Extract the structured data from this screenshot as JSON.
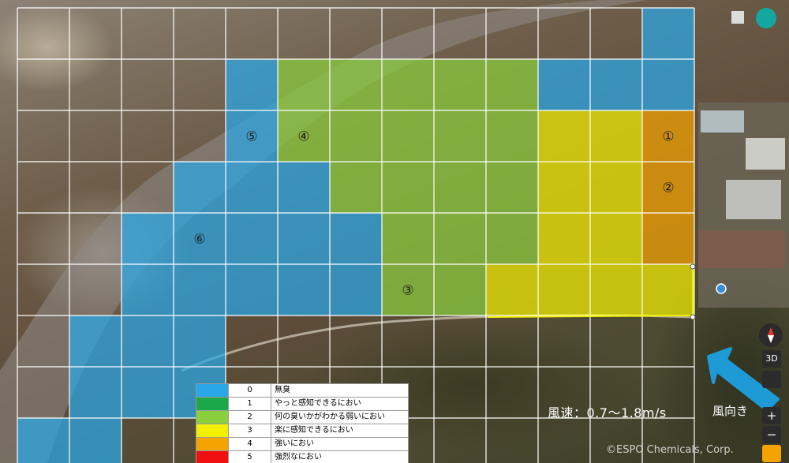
{
  "map": {
    "grid": {
      "columns": 13,
      "rows": 9
    },
    "odor_colors": {
      "0": "#2aa7e8",
      "1": "#1aa84a",
      "2": "#8ccf3e",
      "3": "#f2ef00",
      "4": "#f5a300",
      "5": "#f01010"
    },
    "levels": [
      [
        null,
        null,
        null,
        null,
        null,
        null,
        null,
        null,
        null,
        null,
        null,
        null,
        0
      ],
      [
        null,
        null,
        null,
        null,
        0,
        2,
        2,
        2,
        2,
        2,
        0,
        0,
        0
      ],
      [
        null,
        null,
        null,
        null,
        0,
        2,
        2,
        2,
        2,
        2,
        3,
        3,
        4
      ],
      [
        null,
        null,
        null,
        0,
        0,
        0,
        2,
        2,
        2,
        2,
        3,
        3,
        4
      ],
      [
        null,
        null,
        0,
        0,
        0,
        0,
        0,
        2,
        2,
        2,
        3,
        3,
        4
      ],
      [
        null,
        null,
        0,
        0,
        0,
        0,
        0,
        2,
        2,
        3,
        3,
        3,
        3
      ],
      [
        null,
        0,
        0,
        0,
        null,
        null,
        null,
        null,
        null,
        null,
        null,
        null,
        null
      ],
      [
        null,
        0,
        0,
        0,
        null,
        null,
        null,
        null,
        null,
        null,
        null,
        null,
        null
      ],
      [
        0,
        0,
        null,
        null,
        null,
        null,
        null,
        null,
        null,
        null,
        null,
        null,
        null
      ]
    ],
    "point_labels": [
      {
        "text": "①",
        "col": 12,
        "row": 2
      },
      {
        "text": "②",
        "col": 12,
        "row": 3
      },
      {
        "text": "③",
        "col": 7,
        "row": 5
      },
      {
        "text": "④",
        "col": 5,
        "row": 2
      },
      {
        "text": "⑤",
        "col": 4,
        "row": 2
      },
      {
        "text": "⑥",
        "col": 3,
        "row": 4
      }
    ]
  },
  "legend": [
    {
      "level": "0",
      "label": "無臭",
      "color": "#2aa7e8"
    },
    {
      "level": "1",
      "label": "やっと感知できるにおい",
      "color": "#1aa84a"
    },
    {
      "level": "2",
      "label": "何の臭いかがわかる弱いにおい",
      "color": "#8ccf3e"
    },
    {
      "level": "3",
      "label": "楽に感知できるにおい",
      "color": "#f2ef00"
    },
    {
      "level": "4",
      "label": "強いにおい",
      "color": "#f5a300"
    },
    {
      "level": "5",
      "label": "強烈なにおい",
      "color": "#f01010"
    }
  ],
  "wind": {
    "speed_text": "風速：0.7～1.8m/s",
    "direction_label": "風向き",
    "arrow_color": "#1e9ad6"
  },
  "controls": {
    "three_d": "3D",
    "zoom_in": "+",
    "zoom_out": "−"
  },
  "copyright": "©ESPO Chemicals, Corp."
}
